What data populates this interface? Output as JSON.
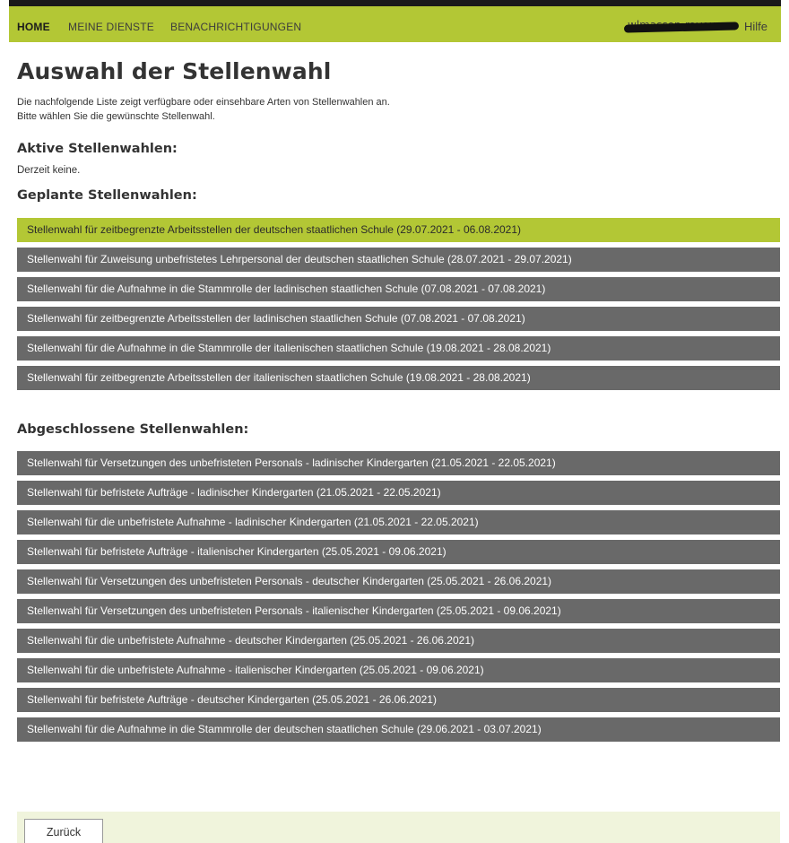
{
  "nav": {
    "home": "HOME",
    "meine_dienste": "MEINE DIENSTE",
    "benachrichtigungen": "BENACHRICHTIGUNGEN",
    "user": "wlmassop-ravou",
    "hilfe": "Hilfe"
  },
  "page": {
    "title": "Auswahl der Stellenwahl",
    "intro_line1": "Die nachfolgende Liste zeigt verfügbare oder einsehbare Arten von Stellenwahlen an.",
    "intro_line2": "Bitte wählen Sie die gewünschte Stellenwahl."
  },
  "aktive": {
    "heading": "Aktive Stellenwahlen:",
    "empty_text": "Derzeit keine."
  },
  "geplante": {
    "heading": "Geplante Stellenwahlen:",
    "items": [
      "Stellenwahl für zeitbegrenzte Arbeitsstellen der deutschen staatlichen Schule (29.07.2021 - 06.08.2021)",
      "Stellenwahl für Zuweisung unbefristetes Lehrpersonal der deutschen staatlichen Schule (28.07.2021 - 29.07.2021)",
      "Stellenwahl für die Aufnahme in die Stammrolle der ladinischen staatlichen Schule (07.08.2021 - 07.08.2021)",
      "Stellenwahl für zeitbegrenzte Arbeitsstellen der ladinischen staatlichen Schule (07.08.2021 - 07.08.2021)",
      "Stellenwahl für die Aufnahme in die Stammrolle der italienischen staatlichen Schule (19.08.2021 - 28.08.2021)",
      "Stellenwahl für zeitbegrenzte Arbeitsstellen der italienischen staatlichen Schule (19.08.2021 - 28.08.2021)"
    ]
  },
  "abgeschlossene": {
    "heading": "Abgeschlossene Stellenwahlen:",
    "items": [
      "Stellenwahl für Versetzungen des unbefristeten Personals - ladinischer Kindergarten (21.05.2021 - 22.05.2021)",
      "Stellenwahl für befristete Aufträge - ladinischer Kindergarten (21.05.2021 - 22.05.2021)",
      "Stellenwahl für die unbefristete Aufnahme - ladinischer Kindergarten (21.05.2021 - 22.05.2021)",
      "Stellenwahl für befristete Aufträge - italienischer Kindergarten (25.05.2021 - 09.06.2021)",
      "Stellenwahl für Versetzungen des unbefristeten Personals - deutscher Kindergarten (25.05.2021 - 26.06.2021)",
      "Stellenwahl für Versetzungen des unbefristeten Personals - italienischer Kindergarten (25.05.2021 - 09.06.2021)",
      "Stellenwahl für die unbefristete Aufnahme - deutscher Kindergarten (25.05.2021 - 26.06.2021)",
      "Stellenwahl für die unbefristete Aufnahme - italienischer Kindergarten (25.05.2021 - 09.06.2021)",
      "Stellenwahl für befristete Aufträge - deutscher Kindergarten (25.05.2021 - 26.06.2021)",
      "Stellenwahl für die Aufnahme in die Stammrolle der deutschen staatlichen Schule (29.06.2021 - 03.07.2021)"
    ]
  },
  "footer": {
    "back_label": "Zurück"
  },
  "colors": {
    "accent": "#b3c735",
    "item_bg": "#696969",
    "footer_bg": "#f0f4dc",
    "topbar_border": "#1a1a1a"
  }
}
